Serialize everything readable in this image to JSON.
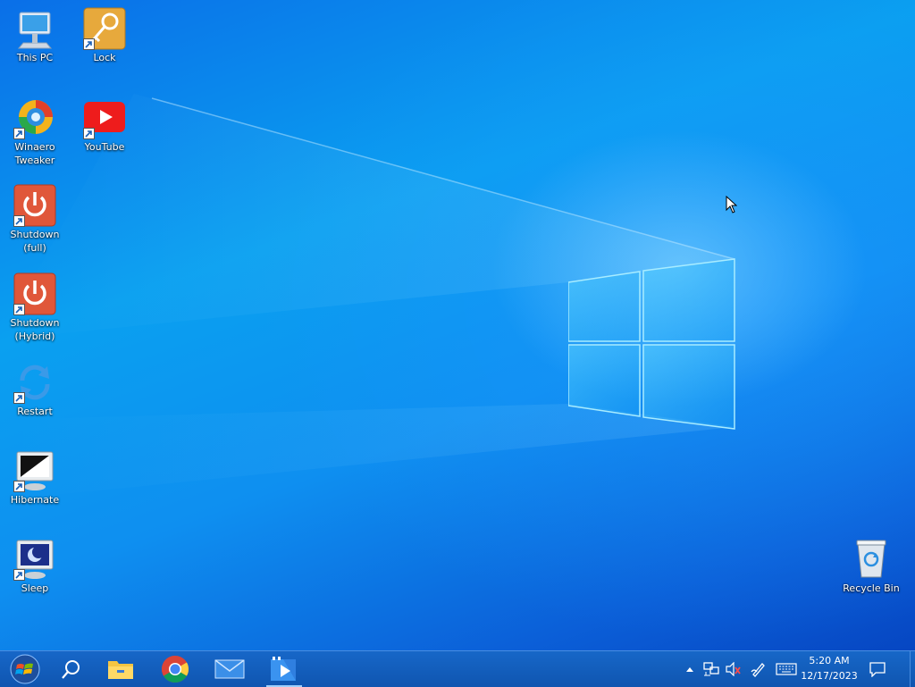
{
  "desktop": {
    "icons": [
      {
        "id": "this-pc",
        "label": "This PC"
      },
      {
        "id": "lock",
        "label": "Lock"
      },
      {
        "id": "winaero-tweaker",
        "label": "Winaero Tweaker"
      },
      {
        "id": "youtube",
        "label": "YouTube"
      },
      {
        "id": "shutdown-full",
        "label": "Shutdown (full)"
      },
      {
        "id": "shutdown-hybrid",
        "label": "Shutdown (Hybrid)"
      },
      {
        "id": "restart",
        "label": "Restart"
      },
      {
        "id": "hibernate",
        "label": "Hibernate"
      },
      {
        "id": "sleep",
        "label": "Sleep"
      },
      {
        "id": "recycle-bin",
        "label": "Recycle Bin"
      }
    ]
  },
  "taskbar": {
    "pinned": [
      "start-orb-icon",
      "search-icon",
      "file-explorer-icon",
      "chrome-icon",
      "mail-icon",
      "media-player-icon"
    ],
    "tray_icons": [
      "chevron-up-icon",
      "network-icon",
      "volume-muted-icon",
      "pen-icon",
      "keyboard-icon",
      "notification-icon"
    ],
    "clock": {
      "time": "5:20 AM",
      "date": "12/17/2023"
    }
  },
  "colors": {
    "accent": "#0f5fc0",
    "wallpaper": "#0a8ff0"
  }
}
